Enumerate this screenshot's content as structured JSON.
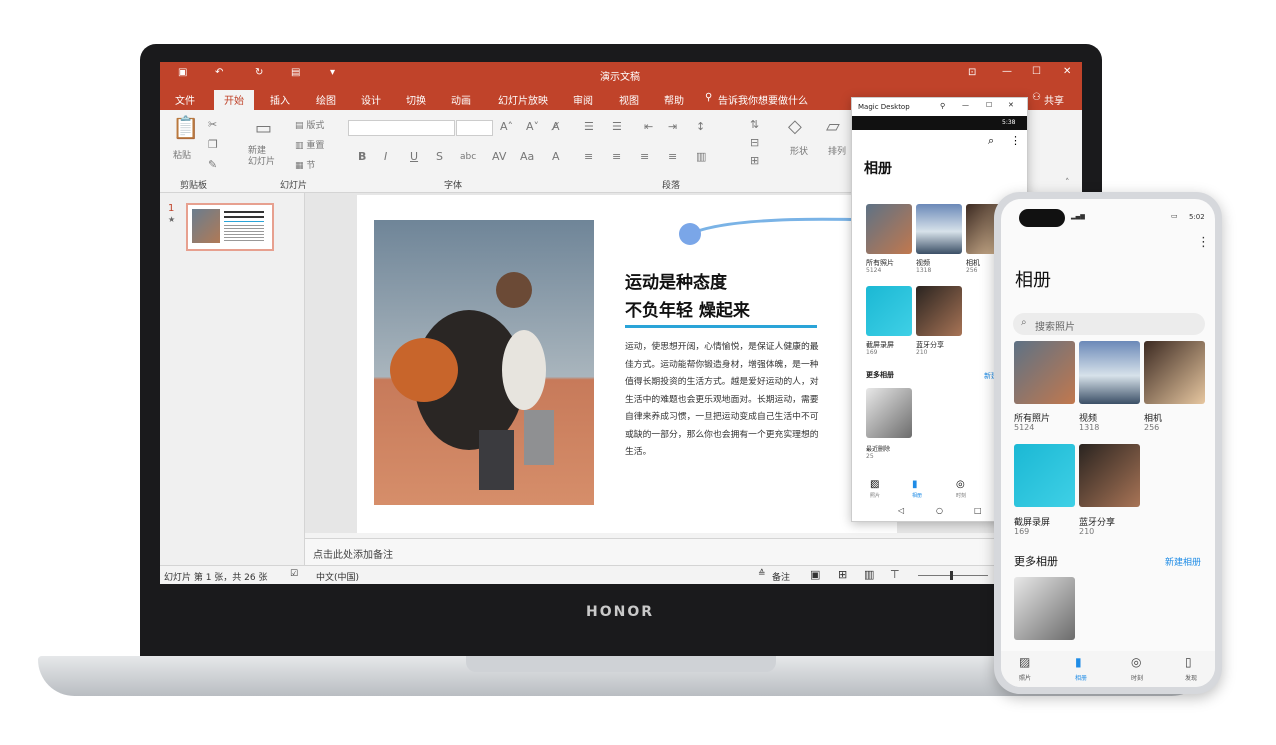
{
  "ppt": {
    "window_title": "演示文稿",
    "tabs": [
      "文件",
      "开始",
      "插入",
      "绘图",
      "设计",
      "切换",
      "动画",
      "幻灯片放映",
      "审阅",
      "视图",
      "帮助"
    ],
    "active_tab": "开始",
    "tell_me": "告诉我你想要做什么",
    "share": "共享",
    "groups": {
      "clipboard": "剪贴板",
      "slides": "幻灯片",
      "font": "字体",
      "paragraph": "段落"
    },
    "buttons": {
      "paste": "粘贴",
      "new_slide": "新建\n幻灯片",
      "layout": "版式",
      "reset": "重置",
      "section": "节",
      "shape": "形状",
      "arrange": "排列"
    },
    "slide_number": "1",
    "notes_placeholder": "点击此处添加备注",
    "status_left": "幻灯片 第 1 张，共 26 张",
    "language": "中文(中国)",
    "notes_btn": "备注"
  },
  "slide": {
    "heading_line1": "运动是种态度",
    "heading_line2": "不负年轻 燥起来",
    "body": "运动，使思想开阔，心情愉悦，是保证人健康的最佳方式。运动能帮你锻造身材，增强体魄，是一种值得长期投资的生活方式。越是爱好运动的人，对生活中的难题也会更乐观地面对。长期运动，需要自律来养成习惯，一旦把运动变成自己生活中不可或缺的一部分，那么你也会拥有一个更充实理想的生活。"
  },
  "laptop_brand": "HONOR",
  "magic_desktop": {
    "title": "Magic Desktop",
    "status_time": "5:38",
    "album_title": "相册",
    "albums": [
      {
        "name": "所有照片",
        "count": "5124"
      },
      {
        "name": "视频",
        "count": "1318"
      },
      {
        "name": "相机",
        "count": "256"
      },
      {
        "name": "截屏录屏",
        "count": "169"
      },
      {
        "name": "蓝牙分享",
        "count": "210"
      }
    ],
    "more_albums": "更多相册",
    "new_album": "新建",
    "recent_deleted": "最近删除",
    "recent_deleted_count": "25",
    "nav": [
      "照片",
      "相册",
      "时刻"
    ]
  },
  "phone": {
    "status_time": "5:02",
    "album_title": "相册",
    "search_placeholder": "搜索照片",
    "albums": [
      {
        "name": "所有照片",
        "count": "5124"
      },
      {
        "name": "视频",
        "count": "1318"
      },
      {
        "name": "相机",
        "count": "256"
      },
      {
        "name": "截屏录屏",
        "count": "169"
      },
      {
        "name": "蓝牙分享",
        "count": "210"
      }
    ],
    "more_albums": "更多相册",
    "new_album": "新建相册",
    "nav": [
      "照片",
      "相册",
      "时刻",
      "发现"
    ]
  },
  "colors": {
    "ppt_accent": "#c0432a",
    "slide_rule": "#2aa4d8",
    "phone_accent": "#1f8ce6"
  }
}
